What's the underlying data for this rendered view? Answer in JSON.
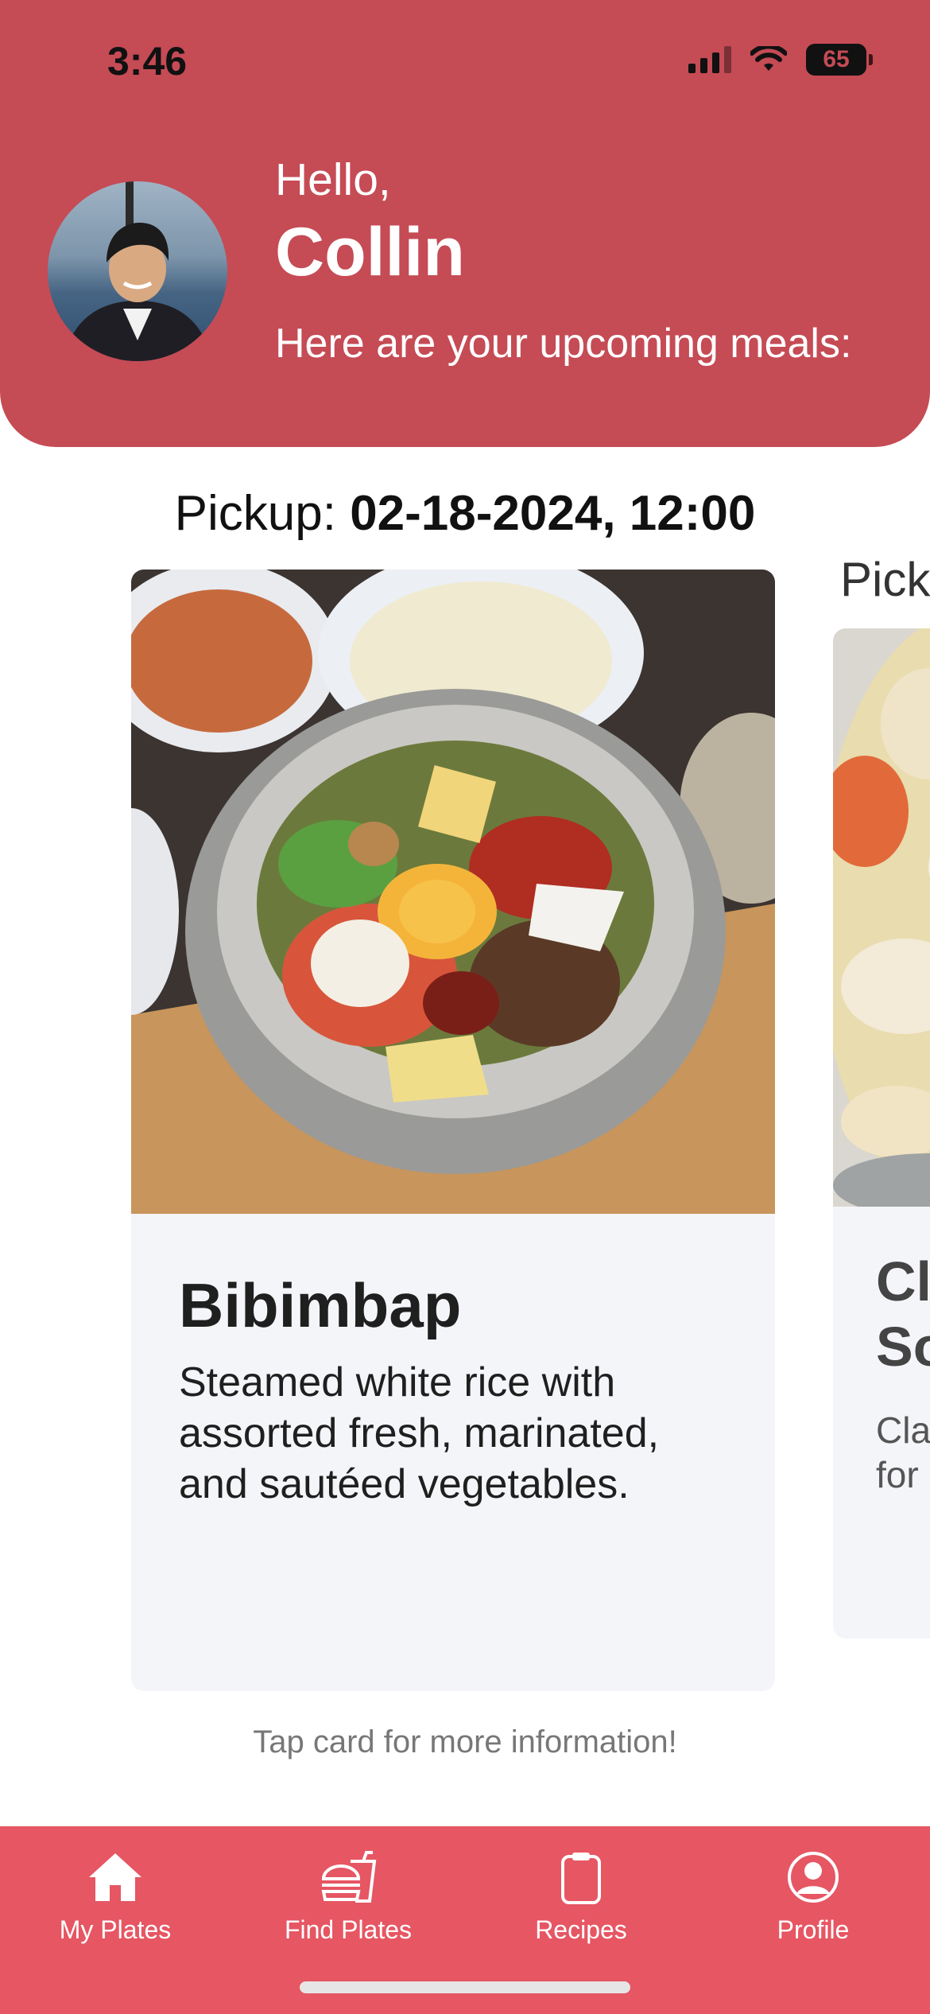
{
  "status_bar": {
    "time": "3:46",
    "battery": "65"
  },
  "header": {
    "greeting": "Hello,",
    "user_name": "Collin",
    "subtitle": "Here are your upcoming meals:"
  },
  "meals": [
    {
      "pickup_label": "Pickup:",
      "pickup_datetime": "02-18-2024, 12:00",
      "title": "Bibimbap",
      "description": "Steamed white rice with assorted fresh, marinated, and sautéed vegetables."
    },
    {
      "pickup_label": "Picku",
      "title_line1": "Cl",
      "title_line2": "So",
      "desc_line1": "Cla",
      "desc_line2": "for"
    }
  ],
  "hint": "Tap card for more information!",
  "tab_bar": {
    "items": [
      {
        "label": "My Plates",
        "icon": "house-icon"
      },
      {
        "label": "Find Plates",
        "icon": "burger-drink-icon"
      },
      {
        "label": "Recipes",
        "icon": "clipboard-icon"
      },
      {
        "label": "Profile",
        "icon": "person-circle-icon"
      }
    ]
  },
  "colors": {
    "header": "#c54b55",
    "tab_bar": "#e65663",
    "card": "#f4f5f9"
  }
}
